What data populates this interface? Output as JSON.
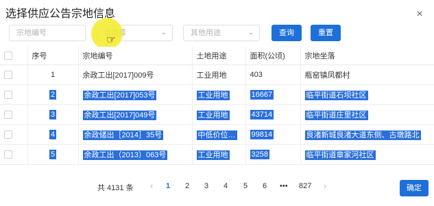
{
  "dialog": {
    "title": "选择供应公告宗地信息",
    "close_icon": "×"
  },
  "filters": {
    "parcel_no_placeholder": "宗地编号",
    "select_placeholder": "请选择",
    "other_use_placeholder": "其他用途",
    "query_label": "查询",
    "reset_label": "重置"
  },
  "table": {
    "headers": [
      "序号",
      "宗地编号",
      "土地用途",
      "面积(公顷)",
      "宗地坐落"
    ],
    "rows": [
      {
        "index": "1",
        "parcel_no": "余政工出[2017]009号",
        "use": "工业用地",
        "area": "403",
        "location": "瓶窑镇凤都村",
        "highlighted": false
      },
      {
        "index": "2",
        "parcel_no": "余政工出[2017]053号",
        "use": "工业用地",
        "area": "16667",
        "location": "临平街道石坝社区",
        "highlighted": true
      },
      {
        "index": "3",
        "parcel_no": "余政工出[2017]049号",
        "use": "工业用地",
        "area": "43714",
        "location": "临平街道庄里社区",
        "highlighted": true
      },
      {
        "index": "4",
        "parcel_no": "余政储出［2014］35号",
        "use": "中低价位…",
        "area": "99814",
        "location": "良渚新城良渚大道东侧、古墩路北",
        "highlighted": true
      },
      {
        "index": "5",
        "parcel_no": "余政工出（2013）063号",
        "use": "工业用地",
        "area": "3258",
        "location": "临平街道章家河社区",
        "highlighted": true
      }
    ]
  },
  "pager": {
    "total": "共 4131 条",
    "pages": [
      "1",
      "2",
      "3",
      "4",
      "5",
      "6",
      "•••",
      "827"
    ],
    "active": "1"
  },
  "confirm_label": "确定",
  "colors": {
    "accent": "#1f6fd8",
    "selection": "#2a6fdb",
    "cursor_highlight": "#f5eb28"
  }
}
